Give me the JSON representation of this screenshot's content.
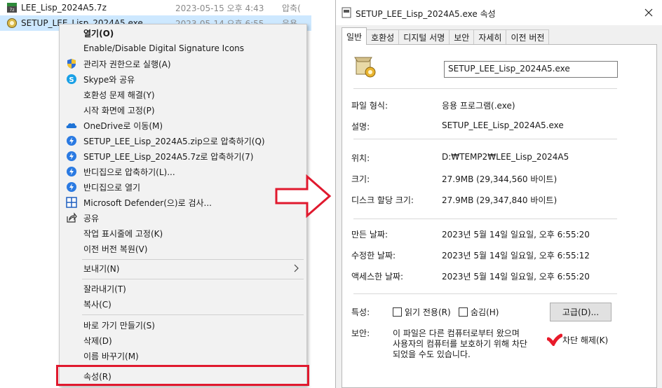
{
  "explorer": {
    "files": [
      {
        "name": "LEE_Lisp_2024A5.7z",
        "date": "2023-05-15 오후 4:43",
        "type": "압축(",
        "icon": "7z-archive-icon"
      },
      {
        "name": "SETUP_LEE_Lisp_2024A5.exe",
        "date": "2023-05-14 오후 6:55",
        "type": "응용",
        "icon": "setup-exe-icon"
      }
    ]
  },
  "context_menu": {
    "items": [
      {
        "label": "열기(O)",
        "bold": true,
        "icon": ""
      },
      {
        "label": "Enable/Disable Digital Signature Icons",
        "icon": ""
      },
      {
        "label": "관리자 권한으로 실행(A)",
        "icon": "uac-shield-icon"
      },
      {
        "label": "Skype와 공유",
        "icon": "skype-icon"
      },
      {
        "label": "호환성 문제 해결(Y)",
        "icon": ""
      },
      {
        "label": "시작 화면에 고정(P)",
        "icon": ""
      },
      {
        "label": "OneDrive로 이동(M)",
        "icon": "onedrive-icon"
      },
      {
        "label": "SETUP_LEE_Lisp_2024A5.zip으로 압축하기(Q)",
        "icon": "bandizip-icon"
      },
      {
        "label": "SETUP_LEE_Lisp_2024A5.7z로 압축하기(7)",
        "icon": "bandizip-icon"
      },
      {
        "label": "반디집으로 압축하기(L)...",
        "icon": "bandizip-icon"
      },
      {
        "label": "반디집으로 열기",
        "icon": "bandizip-icon"
      },
      {
        "label": "Microsoft Defender(으)로 검사...",
        "icon": "defender-icon"
      },
      {
        "label": "공유",
        "icon": "share-icon"
      },
      {
        "label": "작업 표시줄에 고정(K)",
        "icon": ""
      },
      {
        "label": "이전 버전 복원(V)",
        "icon": ""
      },
      {
        "label": "보내기(N)",
        "icon": "",
        "submenu": true
      },
      {
        "label": "잘라내기(T)",
        "icon": ""
      },
      {
        "label": "복사(C)",
        "icon": ""
      },
      {
        "label": "바로 가기 만들기(S)",
        "icon": ""
      },
      {
        "label": "삭제(D)",
        "icon": ""
      },
      {
        "label": "이름 바꾸기(M)",
        "icon": ""
      },
      {
        "label": "속성(R)",
        "icon": "",
        "highlighted": true
      }
    ]
  },
  "properties": {
    "title": "SETUP_LEE_Lisp_2024A5.exe 속성",
    "tabs": [
      "일반",
      "호환성",
      "디지털 서명",
      "보안",
      "자세히",
      "이전 버전"
    ],
    "active_tab": "일반",
    "filename": "SETUP_LEE_Lisp_2024A5.exe",
    "file_type_label": "파일 형식:",
    "file_type_value": "응용 프로그램(.exe)",
    "desc_label": "설명:",
    "desc_value": "SETUP_LEE_Lisp_2024A5.exe",
    "location_label": "위치:",
    "location_value": "D:₩TEMP2₩LEE_Lisp_2024A5",
    "size_label": "크기:",
    "size_value": "27.9MB (29,344,560 바이트)",
    "disk_size_label": "디스크 할당 크기:",
    "disk_size_value": "27.9MB (29,347,840 바이트)",
    "created_label": "만든 날짜:",
    "created_value": "2023년 5월 14일 일요일, 오후 6:55:20",
    "modified_label": "수정한 날짜:",
    "modified_value": "2023년 5월 14일 일요일, 오후 6:55:12",
    "accessed_label": "액세스한 날짜:",
    "accessed_value": "2023년 5월 14일 일요일, 오후 6:55:20",
    "attributes_label": "특성:",
    "readonly_label": "읽기 전용(R)",
    "hidden_label": "숨김(H)",
    "advanced_button": "고급(D)...",
    "security_label": "보안:",
    "security_text_1": "이 파일은 다른 컴퓨터로부터 왔으며",
    "security_text_2": "사용자의 컴퓨터를 보호하기 위해 차단",
    "security_text_3": "되었을 수도 있습니다.",
    "unblock_label": "차단 해제(K)",
    "unblock_checked": true
  },
  "colors": {
    "highlight_red": "#e0192e",
    "selection": "#cde8ff"
  }
}
